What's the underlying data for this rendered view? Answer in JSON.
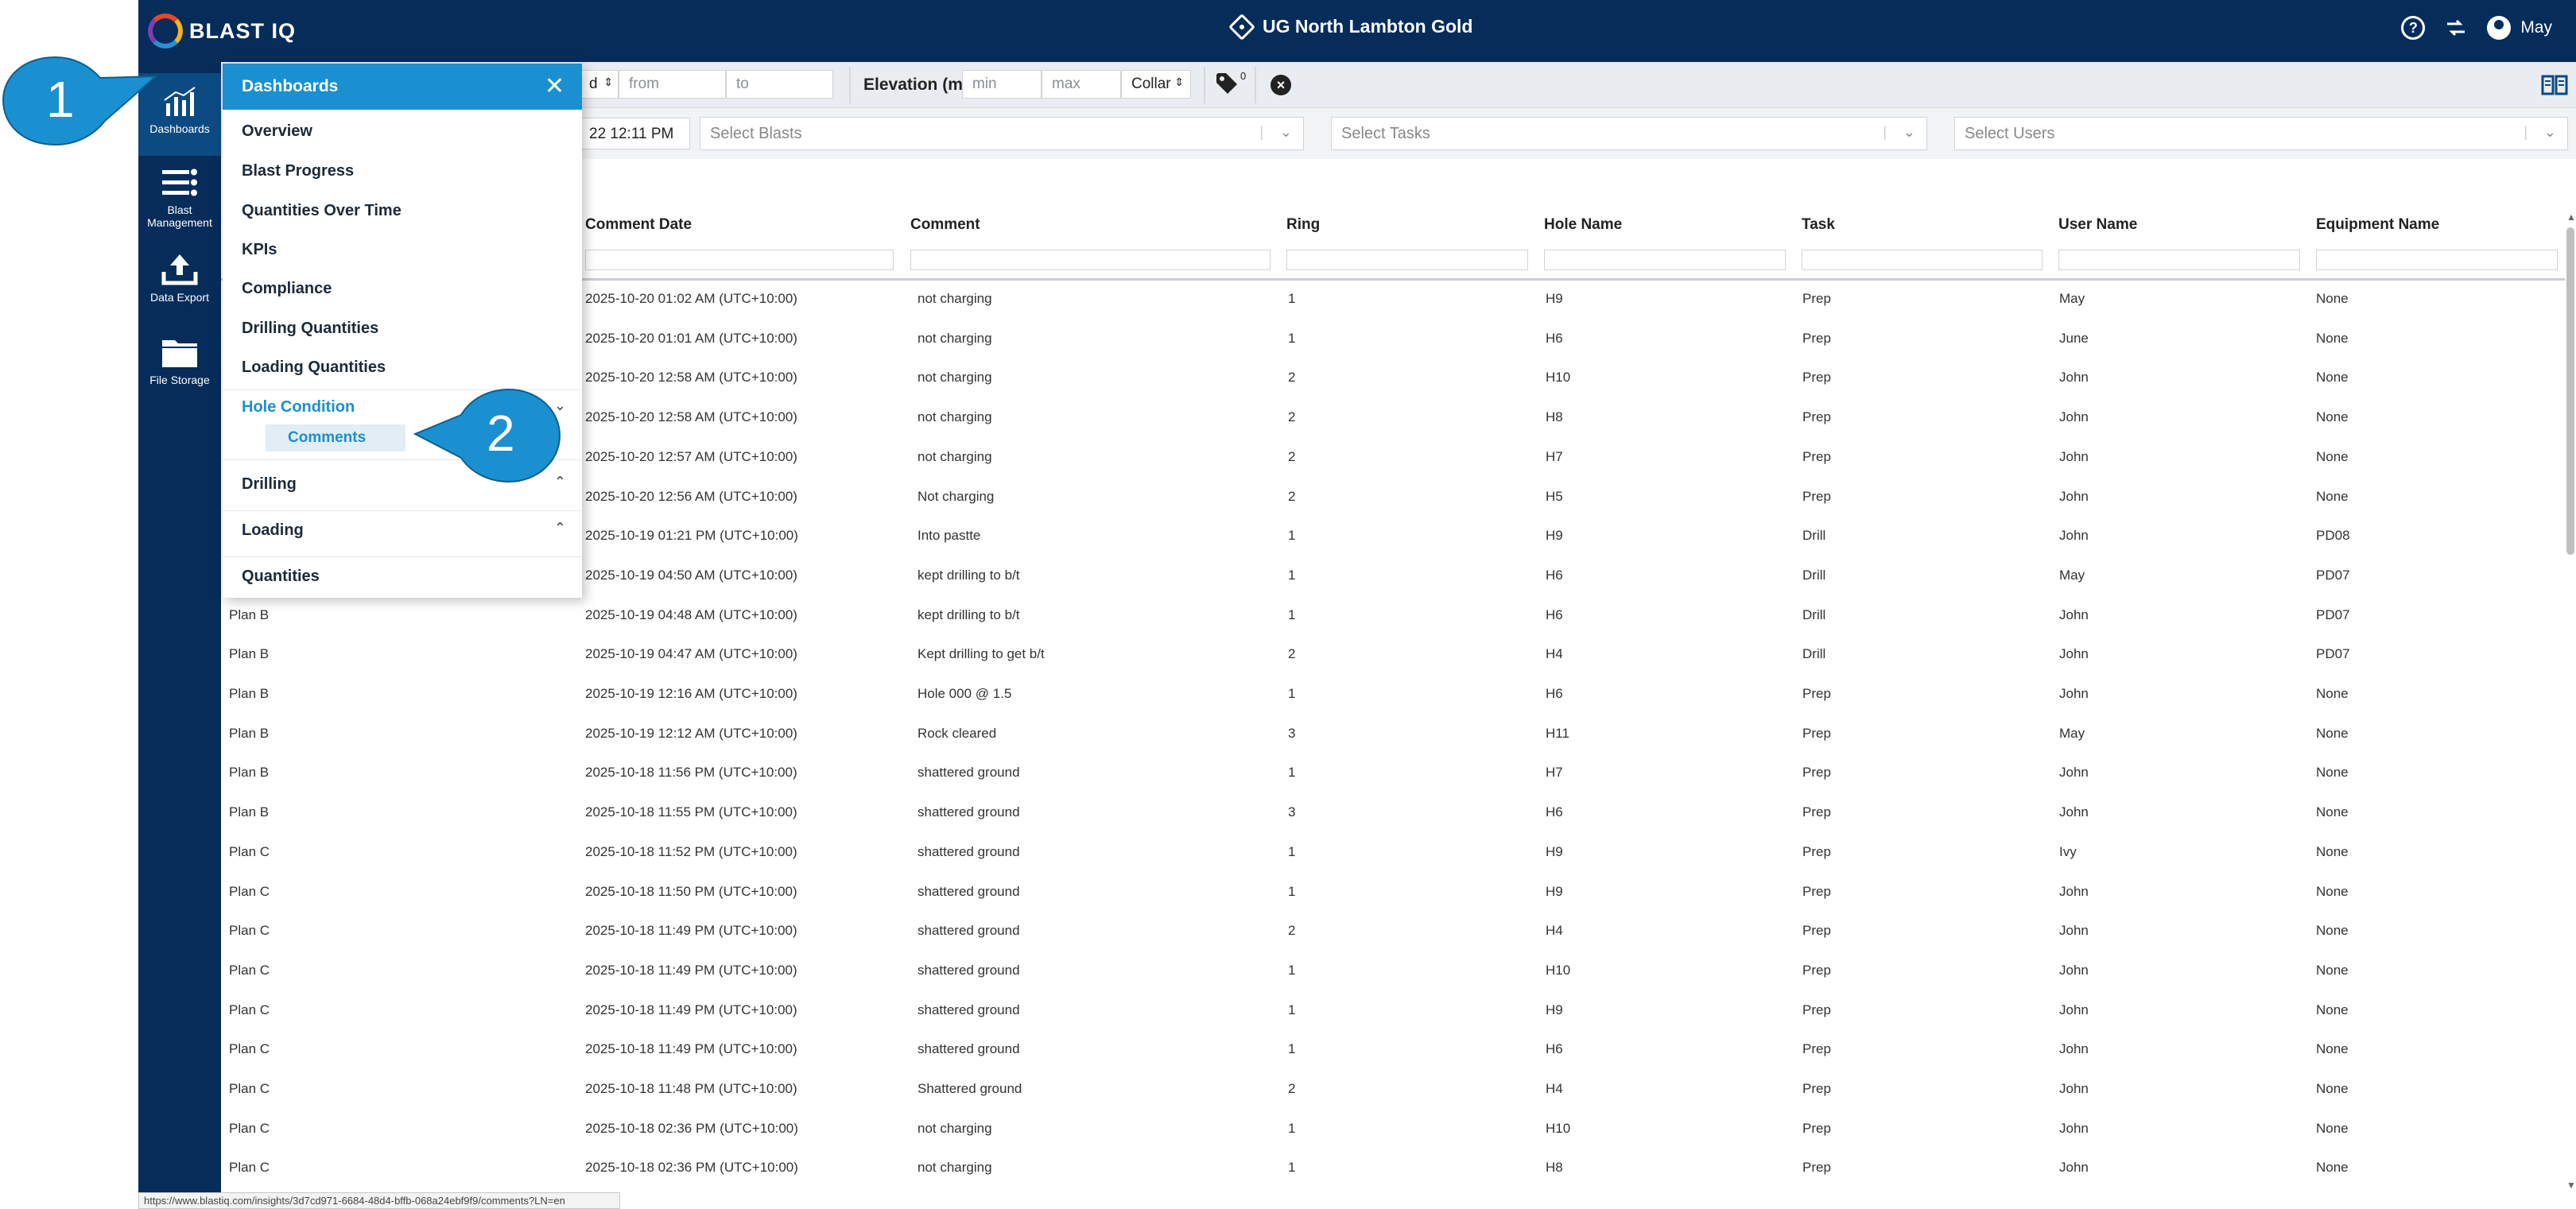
{
  "app": {
    "logo_text": "BLAST IQ",
    "site_name": "UG North Lambton Gold",
    "user_name": "May"
  },
  "icons": {
    "help": "question-circle-icon",
    "switch": "swap-icon",
    "user": "user-circle-icon",
    "panel": "book-panel-icon",
    "tags": "tag-icon",
    "clear": "close-circle-icon"
  },
  "rail": [
    {
      "label": "Dashboards",
      "icon": "chart-icon"
    },
    {
      "label": "Blast Management",
      "icon": "list-icon"
    },
    {
      "label": "Data Export",
      "icon": "upload-icon"
    },
    {
      "label": "File Storage",
      "icon": "folder-icon"
    }
  ],
  "filters": {
    "date_select_partial": "d",
    "from_placeholder": "from",
    "to_placeholder": "to",
    "elevation_label": "Elevation (m)",
    "min_placeholder": "min",
    "max_placeholder": "max",
    "collar_select": "Collar",
    "tag_count": "0",
    "date_value_partial": "22 12:11 PM",
    "blasts_placeholder": "Select Blasts",
    "tasks_placeholder": "Select Tasks",
    "users_placeholder": "Select Users"
  },
  "table": {
    "columns": [
      "Comment Date",
      "Comment",
      "Ring",
      "Hole Name",
      "Task",
      "User Name",
      "Equipment Name"
    ],
    "rows": [
      {
        "plan": "",
        "date": "2025-10-20 01:02 AM (UTC+10:00)",
        "comment": "not charging",
        "ring": "1",
        "hole": "H9",
        "task": "Prep",
        "user": "May",
        "equip": "None"
      },
      {
        "plan": "",
        "date": "2025-10-20 01:01 AM (UTC+10:00)",
        "comment": "not charging",
        "ring": "1",
        "hole": "H6",
        "task": "Prep",
        "user": "June",
        "equip": "None"
      },
      {
        "plan": "",
        "date": "2025-10-20 12:58 AM (UTC+10:00)",
        "comment": "not charging",
        "ring": "2",
        "hole": "H10",
        "task": "Prep",
        "user": "John",
        "equip": "None"
      },
      {
        "plan": "",
        "date": "2025-10-20 12:58 AM (UTC+10:00)",
        "comment": "not charging",
        "ring": "2",
        "hole": "H8",
        "task": "Prep",
        "user": "John",
        "equip": "None"
      },
      {
        "plan": "",
        "date": "2025-10-20 12:57 AM (UTC+10:00)",
        "comment": "not charging",
        "ring": "2",
        "hole": "H7",
        "task": "Prep",
        "user": "John",
        "equip": "None"
      },
      {
        "plan": "",
        "date": "2025-10-20 12:56 AM (UTC+10:00)",
        "comment": "Not charging",
        "ring": "2",
        "hole": "H5",
        "task": "Prep",
        "user": "John",
        "equip": "None"
      },
      {
        "plan": "",
        "date": "2025-10-19 01:21 PM (UTC+10:00)",
        "comment": "Into pastte",
        "ring": "1",
        "hole": "H9",
        "task": "Drill",
        "user": "John",
        "equip": "PD08"
      },
      {
        "plan": "",
        "date": "2025-10-19 04:50 AM (UTC+10:00)",
        "comment": "kept drilling to b/t",
        "ring": "1",
        "hole": "H6",
        "task": "Drill",
        "user": "May",
        "equip": "PD07"
      },
      {
        "plan": "Plan B",
        "date": "2025-10-19 04:48 AM (UTC+10:00)",
        "comment": "kept drilling to b/t",
        "ring": "1",
        "hole": "H6",
        "task": "Drill",
        "user": "John",
        "equip": "PD07"
      },
      {
        "plan": "Plan B",
        "date": "2025-10-19 04:47 AM (UTC+10:00)",
        "comment": "Kept drilling to get b/t",
        "ring": "2",
        "hole": "H4",
        "task": "Drill",
        "user": "John",
        "equip": "PD07"
      },
      {
        "plan": "Plan B",
        "date": "2025-10-19 12:16 AM (UTC+10:00)",
        "comment": "Hole 000 @ 1.5",
        "ring": "1",
        "hole": "H6",
        "task": "Prep",
        "user": "John",
        "equip": "None"
      },
      {
        "plan": "Plan B",
        "date": "2025-10-19 12:12 AM (UTC+10:00)",
        "comment": "Rock cleared",
        "ring": "3",
        "hole": "H11",
        "task": "Prep",
        "user": "May",
        "equip": "None"
      },
      {
        "plan": "Plan B",
        "date": "2025-10-18 11:56 PM (UTC+10:00)",
        "comment": "shattered ground",
        "ring": "1",
        "hole": "H7",
        "task": "Prep",
        "user": "John",
        "equip": "None"
      },
      {
        "plan": "Plan B",
        "date": "2025-10-18 11:55 PM (UTC+10:00)",
        "comment": "shattered ground",
        "ring": "3",
        "hole": "H6",
        "task": "Prep",
        "user": "John",
        "equip": "None"
      },
      {
        "plan": "Plan C",
        "date": "2025-10-18 11:52 PM (UTC+10:00)",
        "comment": "shattered ground",
        "ring": "1",
        "hole": "H9",
        "task": "Prep",
        "user": "Ivy",
        "equip": "None"
      },
      {
        "plan": "Plan C",
        "date": "2025-10-18 11:50 PM (UTC+10:00)",
        "comment": "shattered ground",
        "ring": "1",
        "hole": "H9",
        "task": "Prep",
        "user": "John",
        "equip": "None"
      },
      {
        "plan": "Plan C",
        "date": "2025-10-18 11:49 PM (UTC+10:00)",
        "comment": "shattered ground",
        "ring": "2",
        "hole": "H4",
        "task": "Prep",
        "user": "John",
        "equip": "None"
      },
      {
        "plan": "Plan C",
        "date": "2025-10-18 11:49 PM (UTC+10:00)",
        "comment": "shattered ground",
        "ring": "1",
        "hole": "H10",
        "task": "Prep",
        "user": "John",
        "equip": "None"
      },
      {
        "plan": "Plan C",
        "date": "2025-10-18 11:49 PM (UTC+10:00)",
        "comment": "shattered ground",
        "ring": "1",
        "hole": "H9",
        "task": "Prep",
        "user": "John",
        "equip": "None"
      },
      {
        "plan": "Plan C",
        "date": "2025-10-18 11:49 PM (UTC+10:00)",
        "comment": "shattered ground",
        "ring": "1",
        "hole": "H6",
        "task": "Prep",
        "user": "John",
        "equip": "None"
      },
      {
        "plan": "Plan C",
        "date": "2025-10-18 11:48 PM (UTC+10:00)",
        "comment": "Shattered ground",
        "ring": "2",
        "hole": "H4",
        "task": "Prep",
        "user": "John",
        "equip": "None"
      },
      {
        "plan": "Plan C",
        "date": "2025-10-18 02:36 PM (UTC+10:00)",
        "comment": "not charging",
        "ring": "1",
        "hole": "H10",
        "task": "Prep",
        "user": "John",
        "equip": "None"
      },
      {
        "plan": "Plan C",
        "date": "2025-10-18 02:36 PM (UTC+10:00)",
        "comment": "not charging",
        "ring": "1",
        "hole": "H8",
        "task": "Prep",
        "user": "John",
        "equip": "None"
      }
    ]
  },
  "menu": {
    "title": "Dashboards",
    "items": [
      {
        "label": "Overview"
      },
      {
        "label": "Blast Progress"
      },
      {
        "label": "Quantities Over Time"
      },
      {
        "label": "KPIs"
      },
      {
        "label": "Compliance"
      },
      {
        "label": "Drilling Quantities"
      },
      {
        "label": "Loading Quantities"
      }
    ],
    "hole_condition": "Hole Condition",
    "comments": "Comments",
    "drilling": "Drilling",
    "loading": "Loading",
    "quantities": "Quantities"
  },
  "callouts": {
    "one": "1",
    "two": "2"
  },
  "status_url": "https://www.blastiq.com/insights/3d7cd971-6684-48d4-bffb-068a24ebf9f9/comments?LN=en",
  "colors": {
    "topbar": "#062c5a",
    "accent": "#1a90d0",
    "callout": "#1a90d0"
  }
}
